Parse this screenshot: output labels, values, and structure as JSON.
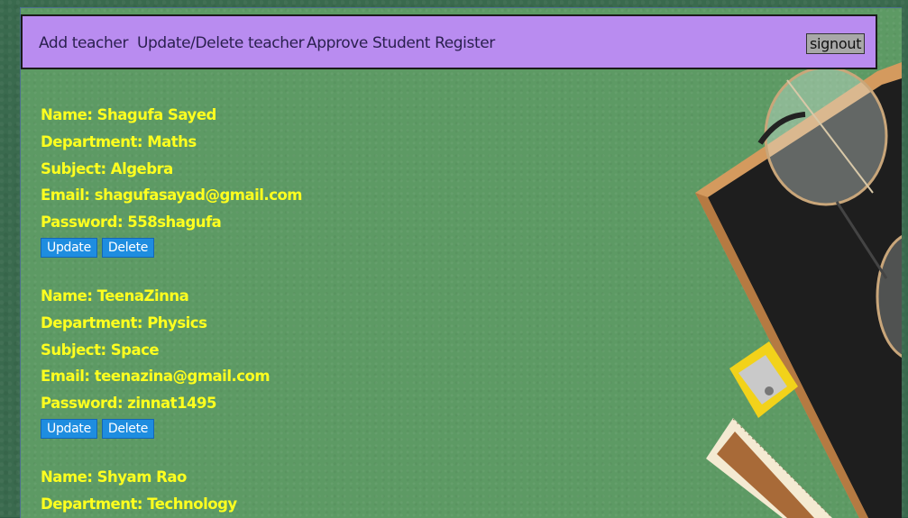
{
  "nav": {
    "add_teacher": "Add teacher",
    "update_delete_teacher": "Update/Delete teacher",
    "approve_student": "Approve Student Register",
    "signout": "signout"
  },
  "teachers": [
    {
      "name": "Name: Shagufa Sayed",
      "department": "Department: Maths",
      "subject": "Subject: Algebra",
      "email": "Email: shagufasayad@gmail.com",
      "password": "Password: 558shagufa",
      "update_label": "Update",
      "delete_label": "Delete"
    },
    {
      "name": "Name: TeenaZinna",
      "department": "Department: Physics",
      "subject": "Subject: Space",
      "email": "Email: teenazina@gmail.com",
      "password": "Password: zinnat1495",
      "update_label": "Update",
      "delete_label": "Delete"
    },
    {
      "name": "Name: Shyam Rao",
      "department": "Department: Technology"
    }
  ],
  "colors": {
    "navbar_bg": "#b98cf0",
    "field_text": "#ffff1f",
    "button_bg": "#1e8de0",
    "page_bg": "#5d9a64"
  }
}
